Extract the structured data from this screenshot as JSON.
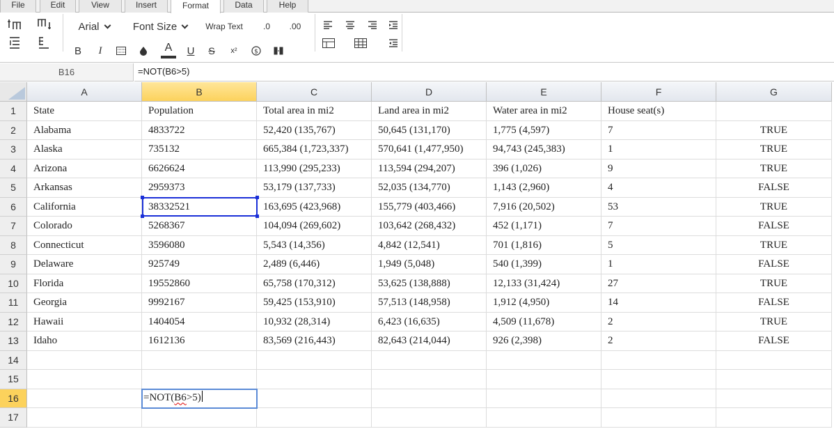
{
  "menu": {
    "tabs": [
      {
        "label": "File"
      },
      {
        "label": "Edit"
      },
      {
        "label": "View"
      },
      {
        "label": "Insert"
      },
      {
        "label": "Format"
      },
      {
        "label": "Data"
      },
      {
        "label": "Help"
      }
    ],
    "active": "Format"
  },
  "toolbar": {
    "font_name": "Arial",
    "font_size_label": "Font Size",
    "wrap_text_label": "Wrap Text",
    "decrease_decimal_label": ".0",
    "increase_decimal_label": ".00",
    "bold_label": "B",
    "italic_label": "I",
    "underline_label": "U",
    "strikethrough_label": "S",
    "font_color_label": "A",
    "superscript_label": "x²"
  },
  "formula_bar": {
    "cell_ref": "B16",
    "formula": "=NOT(B6>5)"
  },
  "sheet": {
    "columns": [
      "A",
      "B",
      "C",
      "D",
      "E",
      "F",
      "G"
    ],
    "selected_column": "B",
    "rows": [
      {
        "num": "1",
        "cells": [
          "State",
          "Population",
          "Total area in mi2",
          "Land area in mi2",
          "Water area in mi2",
          "House seat(s)",
          ""
        ]
      },
      {
        "num": "2",
        "cells": [
          "Alabama",
          "4833722",
          "52,420 (135,767)",
          "50,645 (131,170)",
          "1,775 (4,597)",
          "7",
          "TRUE"
        ]
      },
      {
        "num": "3",
        "cells": [
          "Alaska",
          "735132",
          "665,384 (1,723,337)",
          "570,641 (1,477,950)",
          "94,743 (245,383)",
          "1",
          "TRUE"
        ]
      },
      {
        "num": "4",
        "cells": [
          "Arizona",
          "6626624",
          "113,990 (295,233)",
          "113,594 (294,207)",
          "396 (1,026)",
          "9",
          "TRUE"
        ]
      },
      {
        "num": "5",
        "cells": [
          "Arkansas",
          "2959373",
          "53,179 (137,733)",
          "52,035 (134,770)",
          "1,143 (2,960)",
          "4",
          "FALSE"
        ]
      },
      {
        "num": "6",
        "cells": [
          "California",
          "38332521",
          "163,695 (423,968)",
          "155,779 (403,466)",
          "7,916 (20,502)",
          "53",
          "TRUE"
        ]
      },
      {
        "num": "7",
        "cells": [
          "Colorado",
          "5268367",
          "104,094 (269,602)",
          "103,642 (268,432)",
          "452 (1,171)",
          "7",
          "FALSE"
        ]
      },
      {
        "num": "8",
        "cells": [
          "Connecticut",
          "3596080",
          "5,543 (14,356)",
          "4,842 (12,541)",
          "701 (1,816)",
          "5",
          "TRUE"
        ]
      },
      {
        "num": "9",
        "cells": [
          "Delaware",
          "925749",
          "2,489 (6,446)",
          "1,949 (5,048)",
          "540 (1,399)",
          "1",
          "FALSE"
        ]
      },
      {
        "num": "10",
        "cells": [
          "Florida",
          "19552860",
          "65,758 (170,312)",
          "53,625 (138,888)",
          "12,133 (31,424)",
          "27",
          "TRUE"
        ]
      },
      {
        "num": "11",
        "cells": [
          "Georgia",
          "9992167",
          "59,425 (153,910)",
          "57,513 (148,958)",
          "1,912 (4,950)",
          "14",
          "FALSE"
        ]
      },
      {
        "num": "12",
        "cells": [
          "Hawaii",
          "1404054",
          "10,932 (28,314)",
          "6,423 (16,635)",
          "4,509 (11,678)",
          "2",
          "TRUE"
        ]
      },
      {
        "num": "13",
        "cells": [
          "Idaho",
          "1612136",
          "83,569 (216,443)",
          "82,643 (214,044)",
          "926 (2,398)",
          "2",
          "FALSE"
        ]
      },
      {
        "num": "14",
        "cells": [
          "",
          "",
          "",
          "",
          "",
          "",
          ""
        ]
      },
      {
        "num": "15",
        "cells": [
          "",
          "",
          "",
          "",
          "",
          "",
          ""
        ]
      },
      {
        "num": "16",
        "cells": [
          "",
          "",
          "",
          "",
          "",
          "",
          ""
        ]
      },
      {
        "num": "17",
        "cells": [
          "",
          "",
          "",
          "",
          "",
          "",
          ""
        ]
      }
    ],
    "selected_row": "16",
    "highlighted_cell": "B6",
    "editing_cell": "B16",
    "edit_text_prefix": "=NOT(",
    "edit_text_ref": "B6",
    "edit_text_suffix": ">5)"
  },
  "colors": {
    "selection_border": "#1a2fd8",
    "edit_border": "#5a8ad6",
    "header_highlight": "#fcd25c"
  }
}
